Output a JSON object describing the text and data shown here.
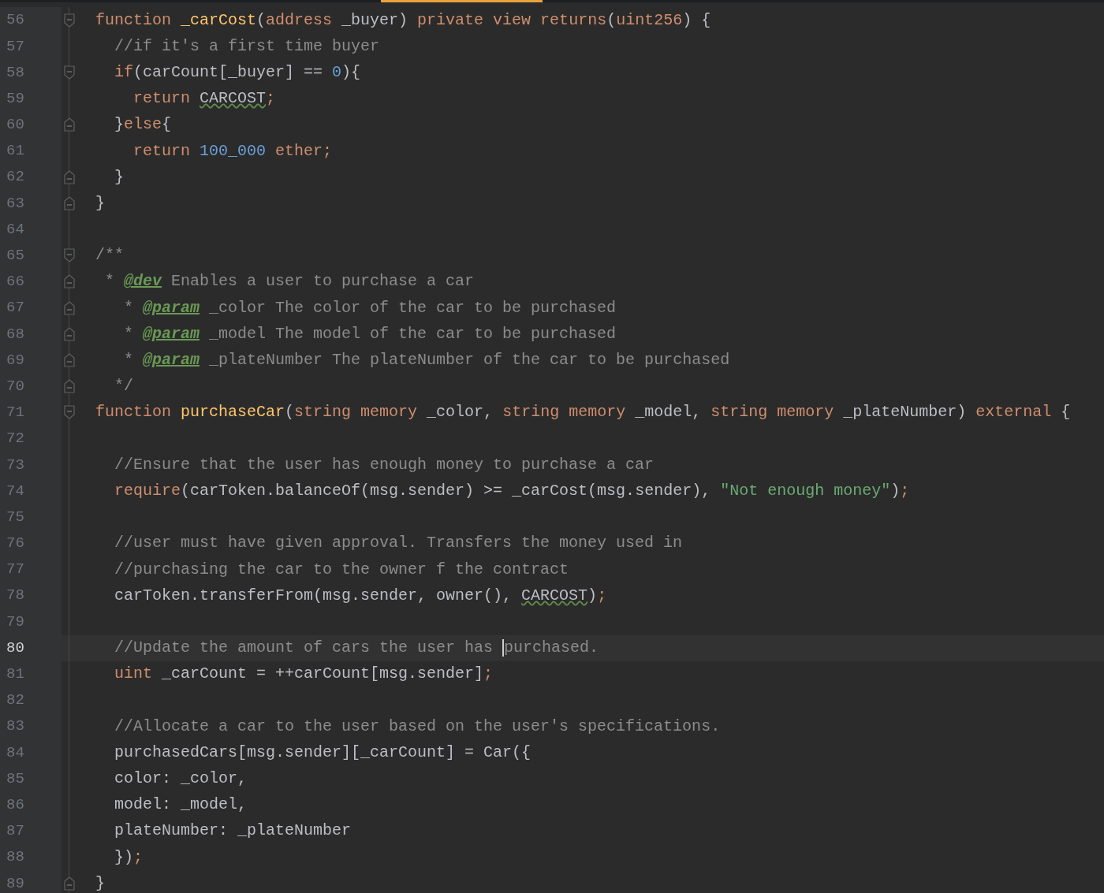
{
  "lines": [
    {
      "number": "56",
      "fold_start": true,
      "fold_end": false,
      "current": false,
      "tokens": [
        {
          "kind": "keyword",
          "text": "function "
        },
        {
          "kind": "function",
          "text": "_carCost"
        },
        {
          "kind": "plain",
          "text": "("
        },
        {
          "kind": "keyword",
          "text": "address "
        },
        {
          "kind": "plain",
          "text": "_buyer) "
        },
        {
          "kind": "keyword",
          "text": "private view returns"
        },
        {
          "kind": "plain",
          "text": "("
        },
        {
          "kind": "keyword",
          "text": "uint256"
        },
        {
          "kind": "plain",
          "text": ") {"
        }
      ]
    },
    {
      "number": "57",
      "fold_start": false,
      "fold_end": false,
      "current": false,
      "tokens": [
        {
          "kind": "comment",
          "text": "  //if it's a first time buyer"
        }
      ]
    },
    {
      "number": "58",
      "fold_start": true,
      "fold_end": false,
      "current": false,
      "tokens": [
        {
          "kind": "keyword",
          "text": "  if"
        },
        {
          "kind": "plain",
          "text": "(carCount[_buyer] == "
        },
        {
          "kind": "number",
          "text": "0"
        },
        {
          "kind": "plain",
          "text": "){"
        }
      ]
    },
    {
      "number": "59",
      "fold_start": false,
      "fold_end": false,
      "current": false,
      "tokens": [
        {
          "kind": "keyword",
          "text": "    return "
        },
        {
          "kind": "warned",
          "text": "CARCOST"
        },
        {
          "kind": "keyword",
          "text": ";"
        }
      ]
    },
    {
      "number": "60",
      "fold_start": false,
      "fold_end": true,
      "current": false,
      "tokens": [
        {
          "kind": "plain",
          "text": "  }"
        },
        {
          "kind": "keyword",
          "text": "else"
        },
        {
          "kind": "plain",
          "text": "{"
        }
      ]
    },
    {
      "number": "61",
      "fold_start": false,
      "fold_end": false,
      "current": false,
      "tokens": [
        {
          "kind": "keyword",
          "text": "    return "
        },
        {
          "kind": "number",
          "text": "100_000"
        },
        {
          "kind": "keyword",
          "text": " ether;"
        }
      ]
    },
    {
      "number": "62",
      "fold_start": false,
      "fold_end": true,
      "current": false,
      "tokens": [
        {
          "kind": "plain",
          "text": "  }"
        }
      ]
    },
    {
      "number": "63",
      "fold_start": false,
      "fold_end": true,
      "current": false,
      "tokens": [
        {
          "kind": "plain",
          "text": "}"
        }
      ]
    },
    {
      "number": "64",
      "fold_start": false,
      "fold_end": false,
      "current": false
    },
    {
      "number": "65",
      "fold_start": true,
      "fold_end": false,
      "current": false,
      "tokens": [
        {
          "kind": "comment",
          "text": "/**"
        }
      ]
    },
    {
      "number": "66",
      "fold_start": false,
      "fold_end": true,
      "current": false,
      "tokens": [
        {
          "kind": "comment",
          "text": " * "
        },
        {
          "kind": "doctag",
          "text": "@dev"
        },
        {
          "kind": "comment",
          "text": " Enables a user to purchase a car"
        }
      ]
    },
    {
      "number": "67",
      "fold_start": false,
      "fold_end": true,
      "current": false,
      "tokens": [
        {
          "kind": "comment",
          "text": "   * "
        },
        {
          "kind": "doctag",
          "text": "@param"
        },
        {
          "kind": "comment",
          "text": " _color The color of the car to be purchased"
        }
      ]
    },
    {
      "number": "68",
      "fold_start": false,
      "fold_end": true,
      "current": false,
      "tokens": [
        {
          "kind": "comment",
          "text": "   * "
        },
        {
          "kind": "doctag",
          "text": "@param"
        },
        {
          "kind": "comment",
          "text": " _model The model of the car to be purchased"
        }
      ]
    },
    {
      "number": "69",
      "fold_start": false,
      "fold_end": true,
      "current": false,
      "tokens": [
        {
          "kind": "comment",
          "text": "   * "
        },
        {
          "kind": "doctag",
          "text": "@param"
        },
        {
          "kind": "comment",
          "text": " _plateNumber The plateNumber of the car to be purchased"
        }
      ]
    },
    {
      "number": "70",
      "fold_start": false,
      "fold_end": true,
      "current": false,
      "tokens": [
        {
          "kind": "comment",
          "text": "  */"
        }
      ]
    },
    {
      "number": "71",
      "fold_start": true,
      "fold_end": false,
      "current": false,
      "tokens": [
        {
          "kind": "keyword",
          "text": "function "
        },
        {
          "kind": "function",
          "text": "purchaseCar"
        },
        {
          "kind": "plain",
          "text": "("
        },
        {
          "kind": "keyword",
          "text": "string memory "
        },
        {
          "kind": "plain",
          "text": "_color, "
        },
        {
          "kind": "keyword",
          "text": "string memory "
        },
        {
          "kind": "plain",
          "text": "_model, "
        },
        {
          "kind": "keyword",
          "text": "string memory "
        },
        {
          "kind": "plain",
          "text": "_plateNumber) "
        },
        {
          "kind": "keyword",
          "text": "external "
        },
        {
          "kind": "plain",
          "text": "{"
        }
      ]
    },
    {
      "number": "72",
      "fold_start": false,
      "fold_end": false,
      "current": false
    },
    {
      "number": "73",
      "fold_start": false,
      "fold_end": false,
      "current": false,
      "tokens": [
        {
          "kind": "comment",
          "text": "  //Ensure that the user has enough money to purchase a car"
        }
      ]
    },
    {
      "number": "74",
      "fold_start": false,
      "fold_end": false,
      "current": false,
      "tokens": [
        {
          "kind": "keyword",
          "text": "  require"
        },
        {
          "kind": "plain",
          "text": "(carToken.balanceOf(msg.sender) >= _carCost(msg.sender), "
        },
        {
          "kind": "string",
          "text": "\"Not enough money\""
        },
        {
          "kind": "plain",
          "text": ")"
        },
        {
          "kind": "keyword",
          "text": ";"
        }
      ]
    },
    {
      "number": "75",
      "fold_start": false,
      "fold_end": false,
      "current": false
    },
    {
      "number": "76",
      "fold_start": false,
      "fold_end": false,
      "current": false,
      "tokens": [
        {
          "kind": "comment",
          "text": "  //user must have given approval. Transfers the money used in"
        }
      ]
    },
    {
      "number": "77",
      "fold_start": false,
      "fold_end": false,
      "current": false,
      "tokens": [
        {
          "kind": "comment",
          "text": "  //purchasing the car to the owner f the contract"
        }
      ]
    },
    {
      "number": "78",
      "fold_start": false,
      "fold_end": false,
      "current": false,
      "tokens": [
        {
          "kind": "plain",
          "text": "  carToken.transferFrom(msg.sender, owner(), "
        },
        {
          "kind": "warned",
          "text": "CARCOST"
        },
        {
          "kind": "plain",
          "text": ")"
        },
        {
          "kind": "keyword",
          "text": ";"
        }
      ]
    },
    {
      "number": "79",
      "fold_start": false,
      "fold_end": false,
      "current": false
    },
    {
      "number": "80",
      "fold_start": false,
      "fold_end": false,
      "current": true,
      "tokens": [
        {
          "kind": "comment",
          "text": "  //Update the amount of cars the user has "
        },
        {
          "kind": "comment",
          "text": "purchased.",
          "caret_before": true
        }
      ]
    },
    {
      "number": "81",
      "fold_start": false,
      "fold_end": false,
      "current": false,
      "tokens": [
        {
          "kind": "keyword",
          "text": "  uint"
        },
        {
          "kind": "plain",
          "text": " _carCount = ++carCount[msg.sender]"
        },
        {
          "kind": "keyword",
          "text": ";"
        }
      ]
    },
    {
      "number": "82",
      "fold_start": false,
      "fold_end": false,
      "current": false
    },
    {
      "number": "83",
      "fold_start": false,
      "fold_end": false,
      "current": false,
      "tokens": [
        {
          "kind": "comment",
          "text": "  //Allocate a car to the user based on the user's specifications."
        }
      ]
    },
    {
      "number": "84",
      "fold_start": false,
      "fold_end": false,
      "current": false,
      "tokens": [
        {
          "kind": "plain",
          "text": "  purchasedCars[msg.sender][_carCount] = Car({"
        }
      ]
    },
    {
      "number": "85",
      "fold_start": false,
      "fold_end": false,
      "current": false,
      "tokens": [
        {
          "kind": "plain",
          "text": "  color: _color,"
        }
      ]
    },
    {
      "number": "86",
      "fold_start": false,
      "fold_end": false,
      "current": false,
      "tokens": [
        {
          "kind": "plain",
          "text": "  model: _model,"
        }
      ]
    },
    {
      "number": "87",
      "fold_start": false,
      "fold_end": false,
      "current": false,
      "tokens": [
        {
          "kind": "plain",
          "text": "  plateNumber: _plateNumber"
        }
      ]
    },
    {
      "number": "88",
      "fold_start": false,
      "fold_end": false,
      "current": false,
      "tokens": [
        {
          "kind": "plain",
          "text": "  })"
        },
        {
          "kind": "keyword",
          "text": ";"
        }
      ]
    },
    {
      "number": "89",
      "fold_start": false,
      "fold_end": true,
      "current": false,
      "tokens": [
        {
          "kind": "plain",
          "text": "}"
        }
      ]
    }
  ]
}
